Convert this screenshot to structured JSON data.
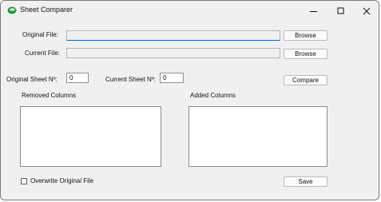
{
  "window": {
    "title": "Sheet Comparer",
    "icon": "green-leaf-app-icon"
  },
  "titlebar_buttons": [
    "minimize-icon",
    "maximize-icon",
    "close-icon"
  ],
  "files": {
    "original_label": "Original File:",
    "original_value": "",
    "current_label": "Current File:",
    "current_value": "",
    "browse_label": "Browse"
  },
  "sheets": {
    "original_label": "Original Sheet Nº:",
    "original_value": "0",
    "current_label": "Current Sheet Nº:",
    "current_value": "0",
    "compare_label": "Compare"
  },
  "columns": {
    "removed_label": "Removed Columns",
    "added_label": "Added Columns"
  },
  "options": {
    "overwrite_label": "Overwrite Original File",
    "overwrite_checked": false,
    "save_label": "Save"
  },
  "colors": {
    "accent": "#0a64c8",
    "window_bg": "#f0f0f0"
  }
}
